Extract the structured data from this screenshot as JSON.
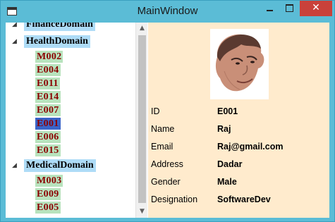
{
  "window": {
    "title": "MainWindow",
    "close_glyph": "✕"
  },
  "tree": {
    "domains": [
      {
        "label": "FinanceDomain",
        "items": []
      },
      {
        "label": "HealthDomain",
        "items": [
          "M002",
          "E004",
          "E011",
          "E014",
          "E007",
          "E001",
          "E006",
          "E015"
        ]
      },
      {
        "label": "MedicalDomain",
        "items": [
          "M003",
          "E009",
          "E005"
        ]
      }
    ],
    "selected_item": "E001"
  },
  "scrollbar": {
    "up_glyph": "▲",
    "down_glyph": "▼"
  },
  "employee": {
    "photo_icon": "person-photo",
    "fields": [
      {
        "label": "ID",
        "value": "E001"
      },
      {
        "label": "Name",
        "value": "Raj"
      },
      {
        "label": "Email",
        "value": "Raj@gmail.com"
      },
      {
        "label": "Address",
        "value": "Dadar"
      },
      {
        "label": "Gender",
        "value": "Male"
      },
      {
        "label": "Designation",
        "value": "SoftwareDev"
      }
    ]
  },
  "colors": {
    "window_frame": "#5bbcd6",
    "close_button": "#c9413a",
    "domain_highlight": "#aedcf7",
    "item_highlight": "#b8e3bd",
    "item_selected": "#3a64c8",
    "item_text": "#8b0000",
    "details_background": "#ffebcd"
  }
}
